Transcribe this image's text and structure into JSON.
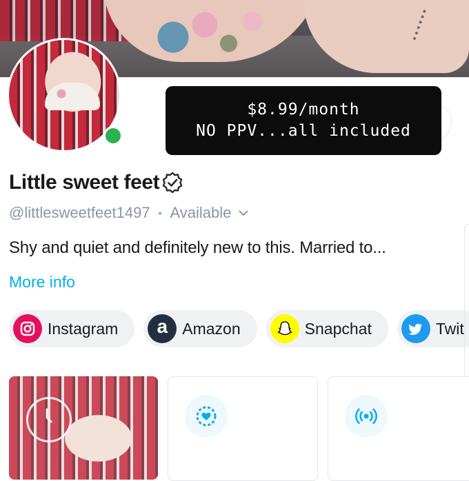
{
  "profile": {
    "name": "Little sweet feet",
    "handle": "@littlesweetfeet1497",
    "status": "Available",
    "bio": "Shy and quiet and definitely new to this. Married to...",
    "more_info": "More info"
  },
  "price_banner": {
    "line1": "$8.99/month",
    "line2": "NO PPV...all included"
  },
  "socials": [
    {
      "label": "Instagram",
      "icon": "instagram-icon",
      "color": "#e4105e"
    },
    {
      "label": "Amazon",
      "icon": "amazon-icon",
      "color": "#232f3e",
      "glyph": "a"
    },
    {
      "label": "Snapchat",
      "icon": "snapchat-icon",
      "color": "#fffc00"
    },
    {
      "label": "Twit",
      "icon": "twitter-icon",
      "color": "#1d9bf0"
    }
  ],
  "tiles": [
    {
      "kind": "image",
      "icon": "play-icon"
    },
    {
      "kind": "stories",
      "icon": "heart-circle-icon"
    },
    {
      "kind": "live",
      "icon": "live-broadcast-icon"
    }
  ],
  "colors": {
    "accent": "#00aff0",
    "online": "#2ab24e",
    "muted_text": "#8a96a3"
  }
}
